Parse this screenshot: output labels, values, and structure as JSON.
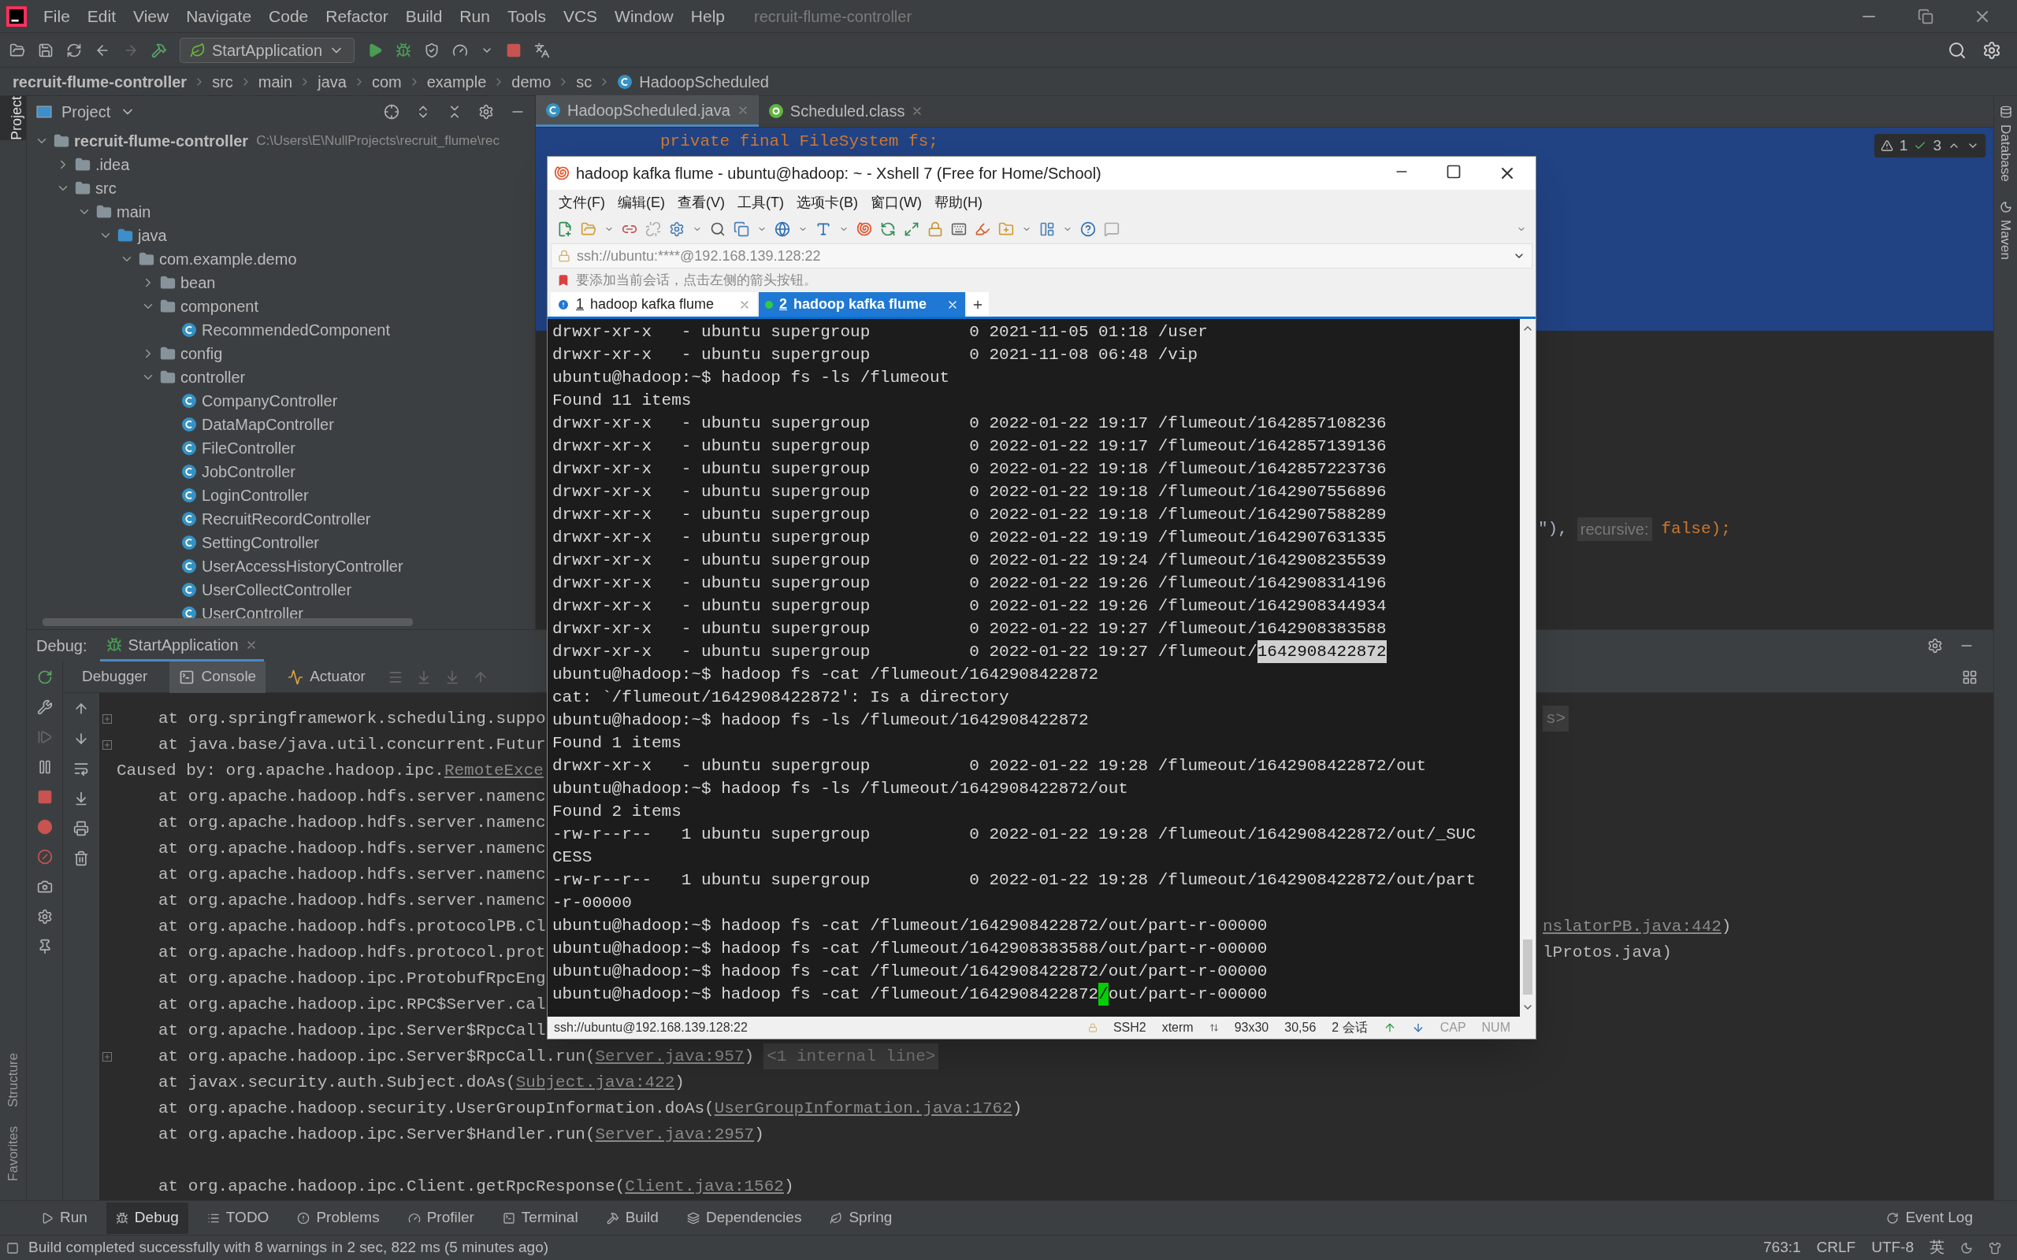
{
  "menu": [
    "File",
    "Edit",
    "View",
    "Navigate",
    "Code",
    "Refactor",
    "Build",
    "Run",
    "Tools",
    "VCS",
    "Window",
    "Help"
  ],
  "window_title": "recruit-flume-controller",
  "run_config": "StartApplication",
  "breadcrumb": [
    "recruit-flume-controller",
    "src",
    "main",
    "java",
    "com",
    "example",
    "demo",
    "sc",
    "HadoopScheduled"
  ],
  "left_strip": {
    "top": {
      "label": "Project",
      "selected": true
    },
    "bottom": [
      {
        "label": "Structure",
        "selected": false
      },
      {
        "label": "Favorites",
        "selected": false
      }
    ]
  },
  "project": {
    "title": "Project",
    "tree": [
      {
        "kind": "module",
        "name": "recruit-flume-controller",
        "path": "C:\\Users\\E\\NullProjects\\recruit_flume\\rec",
        "expanded": true,
        "children": [
          {
            "kind": "folder",
            "name": ".idea",
            "expanded": false
          },
          {
            "kind": "folder",
            "name": "src",
            "expanded": true,
            "children": [
              {
                "kind": "folder",
                "name": "main",
                "expanded": true,
                "children": [
                  {
                    "kind": "source",
                    "name": "java",
                    "expanded": true,
                    "children": [
                      {
                        "kind": "package",
                        "name": "com.example.demo",
                        "expanded": true,
                        "children": [
                          {
                            "kind": "package",
                            "name": "bean",
                            "expanded": false
                          },
                          {
                            "kind": "package",
                            "name": "component",
                            "expanded": true,
                            "children": [
                              {
                                "kind": "class",
                                "name": "RecommendedComponent"
                              }
                            ]
                          },
                          {
                            "kind": "package",
                            "name": "config",
                            "expanded": false
                          },
                          {
                            "kind": "package",
                            "name": "controller",
                            "expanded": true,
                            "children": [
                              {
                                "kind": "class",
                                "name": "CompanyController"
                              },
                              {
                                "kind": "class",
                                "name": "DataMapController"
                              },
                              {
                                "kind": "class",
                                "name": "FileController"
                              },
                              {
                                "kind": "class",
                                "name": "JobController"
                              },
                              {
                                "kind": "class",
                                "name": "LoginController"
                              },
                              {
                                "kind": "class",
                                "name": "RecruitRecordController"
                              },
                              {
                                "kind": "class",
                                "name": "SettingController"
                              },
                              {
                                "kind": "class",
                                "name": "UserAccessHistoryController"
                              },
                              {
                                "kind": "class",
                                "name": "UserCollectController"
                              },
                              {
                                "kind": "class",
                                "name": "UserController"
                              }
                            ]
                          }
                        ]
                      }
                    ]
                  }
                ]
              }
            ]
          }
        ]
      }
    ]
  },
  "editor": {
    "tabs": [
      {
        "label": "HadoopScheduled.java",
        "kind": "class",
        "selected": true
      },
      {
        "label": "Scheduled.class",
        "kind": "annotation",
        "selected": false
      }
    ],
    "code_top": "private final FileSystem fs;",
    "code_tail": {
      "text": "\"),",
      "hint": "recursive:",
      "keyword": "false",
      "end": ");"
    },
    "warnings": "1",
    "checks": "3"
  },
  "right_strip": [
    "Database",
    "Maven"
  ],
  "debug": {
    "label": "Debug:",
    "session": "StartApplication",
    "tabs": [
      {
        "label": "Debugger",
        "selected": false
      },
      {
        "label": "Console",
        "selected": true
      },
      {
        "label": "Actuator",
        "selected": false
      }
    ],
    "lines": [
      {
        "kind": "frame",
        "fold": true,
        "parts": [
          {
            "kind": "plain",
            "text": "at org.springframework.scheduling.suppo"
          }
        ],
        "right": [
          {
            "kind": "hint",
            "text": "s>"
          }
        ]
      },
      {
        "kind": "frame",
        "fold": true,
        "parts": [
          {
            "kind": "plain",
            "text": "at java.base/java.util.concurrent.Futur"
          }
        ]
      },
      {
        "kind": "cause",
        "fold": false,
        "parts": [
          {
            "kind": "plain",
            "text": "Caused by: org.apache.hadoop.ipc."
          },
          {
            "kind": "link",
            "text": "RemoteExce"
          }
        ]
      },
      {
        "kind": "frame",
        "fold": false,
        "parts": [
          {
            "kind": "plain",
            "text": "at org.apache.hadoop.hdfs.server.namenc"
          }
        ]
      },
      {
        "kind": "frame",
        "fold": false,
        "parts": [
          {
            "kind": "plain",
            "text": "at org.apache.hadoop.hdfs.server.namenc"
          }
        ]
      },
      {
        "kind": "frame",
        "fold": false,
        "parts": [
          {
            "kind": "plain",
            "text": "at org.apache.hadoop.hdfs.server.namenc"
          }
        ]
      },
      {
        "kind": "frame",
        "fold": false,
        "parts": [
          {
            "kind": "plain",
            "text": "at org.apache.hadoop.hdfs.server.namenc"
          }
        ]
      },
      {
        "kind": "frame",
        "fold": false,
        "parts": [
          {
            "kind": "plain",
            "text": "at org.apache.hadoop.hdfs.server.namenc"
          }
        ]
      },
      {
        "kind": "frame",
        "fold": false,
        "parts": [
          {
            "kind": "plain",
            "text": "at org.apache.hadoop.hdfs.protocolPB.Cl"
          }
        ],
        "right": [
          {
            "kind": "link",
            "text": "nslatorPB.java:442"
          },
          {
            "kind": "plain",
            "text": ")"
          }
        ]
      },
      {
        "kind": "frame",
        "fold": false,
        "parts": [
          {
            "kind": "plain",
            "text": "at org.apache.hadoop.hdfs.protocol.prot"
          }
        ],
        "right": [
          {
            "kind": "plain",
            "text": "lProtos.java)"
          }
        ]
      },
      {
        "kind": "frame",
        "fold": false,
        "parts": [
          {
            "kind": "plain",
            "text": "at org.apache.hadoop.ipc.ProtobufRpcEng"
          }
        ]
      },
      {
        "kind": "frame",
        "fold": false,
        "parts": [
          {
            "kind": "plain",
            "text": "at org.apache.hadoop.ipc.RPC$Server.cal"
          }
        ]
      },
      {
        "kind": "frame",
        "fold": false,
        "parts": [
          {
            "kind": "plain",
            "text": "at org.apache.hadoop.ipc.Server$RpcCall"
          }
        ]
      },
      {
        "kind": "frame",
        "fold": true,
        "parts": [
          {
            "kind": "plain",
            "text": "at org.apache.hadoop.ipc.Server$RpcCall.run("
          },
          {
            "kind": "link",
            "text": "Server.java:957"
          },
          {
            "kind": "plain",
            "text": ")"
          },
          {
            "kind": "hint",
            "text": "<1 internal line>"
          }
        ]
      },
      {
        "kind": "frame",
        "fold": false,
        "parts": [
          {
            "kind": "plain",
            "text": "at javax.security.auth.Subject.doAs("
          },
          {
            "kind": "link",
            "text": "Subject.java:422"
          },
          {
            "kind": "plain",
            "text": ")"
          }
        ]
      },
      {
        "kind": "frame",
        "fold": false,
        "parts": [
          {
            "kind": "plain",
            "text": "at org.apache.hadoop.security.UserGroupInformation.doAs("
          },
          {
            "kind": "link",
            "text": "UserGroupInformation.java:1762"
          },
          {
            "kind": "plain",
            "text": ")"
          }
        ]
      },
      {
        "kind": "frame",
        "fold": false,
        "parts": [
          {
            "kind": "plain",
            "text": "at org.apache.hadoop.ipc.Server$Handler.run("
          },
          {
            "kind": "link",
            "text": "Server.java:2957"
          },
          {
            "kind": "plain",
            "text": ")"
          }
        ]
      },
      {
        "kind": "blank"
      },
      {
        "kind": "frame",
        "fold": false,
        "parts": [
          {
            "kind": "plain",
            "text": "at org.apache.hadoop.ipc.Client.getRpcResponse("
          },
          {
            "kind": "link",
            "text": "Client.java:1562"
          },
          {
            "kind": "plain",
            "text": ")"
          }
        ]
      }
    ]
  },
  "tool_tabs": [
    {
      "label": "Run",
      "selected": false
    },
    {
      "label": "Debug",
      "selected": true
    },
    {
      "label": "TODO",
      "selected": false
    },
    {
      "label": "Problems",
      "selected": false
    },
    {
      "label": "Profiler",
      "selected": false
    },
    {
      "label": "Terminal",
      "selected": false
    },
    {
      "label": "Build",
      "selected": false
    },
    {
      "label": "Dependencies",
      "selected": false
    },
    {
      "label": "Spring",
      "selected": false
    }
  ],
  "event_log": "Event Log",
  "status": {
    "message": "Build completed successfully with 8 warnings in 2 sec, 822 ms (5 minutes ago)",
    "position": "763:1",
    "line_sep": "CRLF",
    "encoding": "UTF-8",
    "ime": "英"
  },
  "xshell": {
    "title": "hadoop kafka flume - ubuntu@hadoop: ~ - Xshell 7 (Free for Home/School)",
    "menu": [
      "文件(F)",
      "编辑(E)",
      "查看(V)",
      "工具(T)",
      "选项卡(B)",
      "窗口(W)",
      "帮助(H)"
    ],
    "address": "ssh://ubuntu:****@192.168.139.128:22",
    "hint": "要添加当前会话，点击左侧的箭头按钮。",
    "tabs": [
      {
        "number": "1",
        "label": "hadoop kafka flume",
        "selected": false
      },
      {
        "number": "2",
        "label": "hadoop kafka flume",
        "selected": true
      }
    ],
    "lines": [
      {
        "text": "drwxr-xr-x   - ubuntu supergroup          0 2021-11-05 01:18 /user"
      },
      {
        "text": "drwxr-xr-x   - ubuntu supergroup          0 2021-11-08 06:48 /vip"
      },
      {
        "text": "ubuntu@hadoop:~$ hadoop fs -ls /flumeout"
      },
      {
        "text": "Found 11 items"
      },
      {
        "text": "drwxr-xr-x   - ubuntu supergroup          0 2022-01-22 19:17 /flumeout/1642857108236"
      },
      {
        "text": "drwxr-xr-x   - ubuntu supergroup          0 2022-01-22 19:17 /flumeout/1642857139136"
      },
      {
        "text": "drwxr-xr-x   - ubuntu supergroup          0 2022-01-22 19:18 /flumeout/1642857223736"
      },
      {
        "text": "drwxr-xr-x   - ubuntu supergroup          0 2022-01-22 19:18 /flumeout/1642907556896"
      },
      {
        "text": "drwxr-xr-x   - ubuntu supergroup          0 2022-01-22 19:18 /flumeout/1642907588289"
      },
      {
        "text": "drwxr-xr-x   - ubuntu supergroup          0 2022-01-22 19:19 /flumeout/1642907631335"
      },
      {
        "text": "drwxr-xr-x   - ubuntu supergroup          0 2022-01-22 19:24 /flumeout/1642908235539"
      },
      {
        "text": "drwxr-xr-x   - ubuntu supergroup          0 2022-01-22 19:26 /flumeout/1642908314196"
      },
      {
        "text": "drwxr-xr-x   - ubuntu supergroup          0 2022-01-22 19:26 /flumeout/1642908344934"
      },
      {
        "text": "drwxr-xr-x   - ubuntu supergroup          0 2022-01-22 19:27 /flumeout/1642908383588"
      },
      {
        "text": "drwxr-xr-x   - ubuntu supergroup          0 2022-01-22 19:27 /flumeout/",
        "highlight": "1642908422872"
      },
      {
        "text": "ubuntu@hadoop:~$ hadoop fs -cat /flumeout/1642908422872"
      },
      {
        "text": "cat: `/flumeout/1642908422872': Is a directory"
      },
      {
        "text": "ubuntu@hadoop:~$ hadoop fs -ls /flumeout/1642908422872"
      },
      {
        "text": "Found 1 items"
      },
      {
        "text": "drwxr-xr-x   - ubuntu supergroup          0 2022-01-22 19:28 /flumeout/1642908422872/out"
      },
      {
        "text": "ubuntu@hadoop:~$ hadoop fs -ls /flumeout/1642908422872/out"
      },
      {
        "text": "Found 2 items"
      },
      {
        "text": "-rw-r--r--   1 ubuntu supergroup          0 2022-01-22 19:28 /flumeout/1642908422872/out/_SUC"
      },
      {
        "text": "CESS"
      },
      {
        "text": "-rw-r--r--   1 ubuntu supergroup          0 2022-01-22 19:28 /flumeout/1642908422872/out/part"
      },
      {
        "text": "-r-00000"
      },
      {
        "text": "ubuntu@hadoop:~$ hadoop fs -cat /flumeout/1642908422872/out/part-r-00000"
      },
      {
        "text": "ubuntu@hadoop:~$ hadoop fs -cat /flumeout/1642908383588/out/part-r-00000"
      },
      {
        "text": "ubuntu@hadoop:~$ hadoop fs -cat /flumeout/1642908422872/out/part-r-00000"
      },
      {
        "text": "ubuntu@hadoop:~$ hadoop fs -cat /flumeout/1642908422872",
        "cursor": "/",
        "rest": "out/part-r-00000"
      }
    ],
    "status": {
      "address": "ssh://ubuntu@192.168.139.128:22",
      "protocol": "SSH2",
      "term": "xterm",
      "size": "93x30",
      "cursor": "30,56",
      "sessions": "2 会话",
      "caps": "CAP",
      "num": "NUM"
    }
  }
}
